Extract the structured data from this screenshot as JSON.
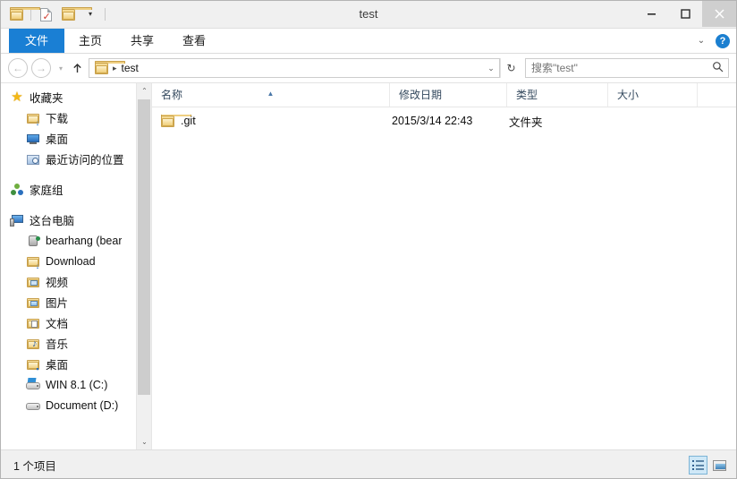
{
  "window": {
    "title": "test",
    "controls": {
      "minimize": "minimize",
      "maximize": "maximize",
      "close": "close"
    }
  },
  "quick_access": {
    "items": [
      {
        "name": "folder-properties",
        "icon": "folder-icon"
      },
      {
        "name": "new-folder",
        "icon": "document-check-icon"
      },
      {
        "name": "folder-up",
        "icon": "folder-icon"
      }
    ],
    "customize_caret": "▾"
  },
  "ribbon": {
    "tabs": [
      {
        "label": "文件",
        "selected": true
      },
      {
        "label": "主页",
        "selected": false
      },
      {
        "label": "共享",
        "selected": false
      },
      {
        "label": "查看",
        "selected": false
      }
    ],
    "expand_caret": "⌄",
    "help_label": "?"
  },
  "address": {
    "back_glyph": "←",
    "forward_glyph": "→",
    "history_caret": "▾",
    "up_glyph": "↑",
    "crumb_separator": "▸",
    "path_segments": [
      "test"
    ],
    "dropdown_caret": "⌄",
    "refresh_glyph": "↻"
  },
  "search": {
    "placeholder": "搜索\"test\"",
    "value": "",
    "icon": "search-icon"
  },
  "sidebar": {
    "groups": [
      {
        "header": {
          "label": "收藏夹",
          "icon": "star-icon"
        },
        "items": [
          {
            "label": "下载",
            "icon": "download-folder-icon"
          },
          {
            "label": "桌面",
            "icon": "desktop-monitor-icon"
          },
          {
            "label": "最近访问的位置",
            "icon": "recent-places-icon"
          }
        ]
      },
      {
        "header": {
          "label": "家庭组",
          "icon": "homegroup-icon"
        },
        "items": []
      },
      {
        "header": {
          "label": "这台电脑",
          "icon": "this-pc-icon"
        },
        "items": [
          {
            "label": "bearhang (bear",
            "icon": "user-icon"
          },
          {
            "label": "Download",
            "icon": "download-folder-icon"
          },
          {
            "label": "视频",
            "icon": "videos-folder-icon"
          },
          {
            "label": "图片",
            "icon": "pictures-folder-icon"
          },
          {
            "label": "文档",
            "icon": "documents-folder-icon"
          },
          {
            "label": "音乐",
            "icon": "music-folder-icon"
          },
          {
            "label": "桌面",
            "icon": "desktop-folder-icon"
          },
          {
            "label": "WIN 8.1 (C:)",
            "icon": "windows-drive-icon"
          },
          {
            "label": "Document (D:)",
            "icon": "drive-icon"
          }
        ]
      }
    ],
    "scrollbar": {
      "up_glyph": "⌃",
      "down_glyph": "⌄"
    }
  },
  "filelist": {
    "columns": [
      {
        "label": "名称",
        "sorted": true,
        "sort_caret": "▲"
      },
      {
        "label": "修改日期",
        "sorted": false,
        "sort_caret": ""
      },
      {
        "label": "类型",
        "sorted": false,
        "sort_caret": ""
      },
      {
        "label": "大小",
        "sorted": false,
        "sort_caret": ""
      }
    ],
    "rows": [
      {
        "name": ".git",
        "icon": "folder-icon",
        "date_modified": "2015/3/14 22:43",
        "type": "文件夹",
        "size": ""
      }
    ]
  },
  "statusbar": {
    "item_count": "1 个项目",
    "views": [
      {
        "name": "details-view",
        "active": true
      },
      {
        "name": "large-icons-view",
        "active": false
      }
    ]
  },
  "colors": {
    "accent_blue": "#1a7fd4",
    "folder_yellow": "#e7bf62",
    "titlebar_bg": "#f0f0f0",
    "selected_view_bg": "#cfe8f7"
  }
}
